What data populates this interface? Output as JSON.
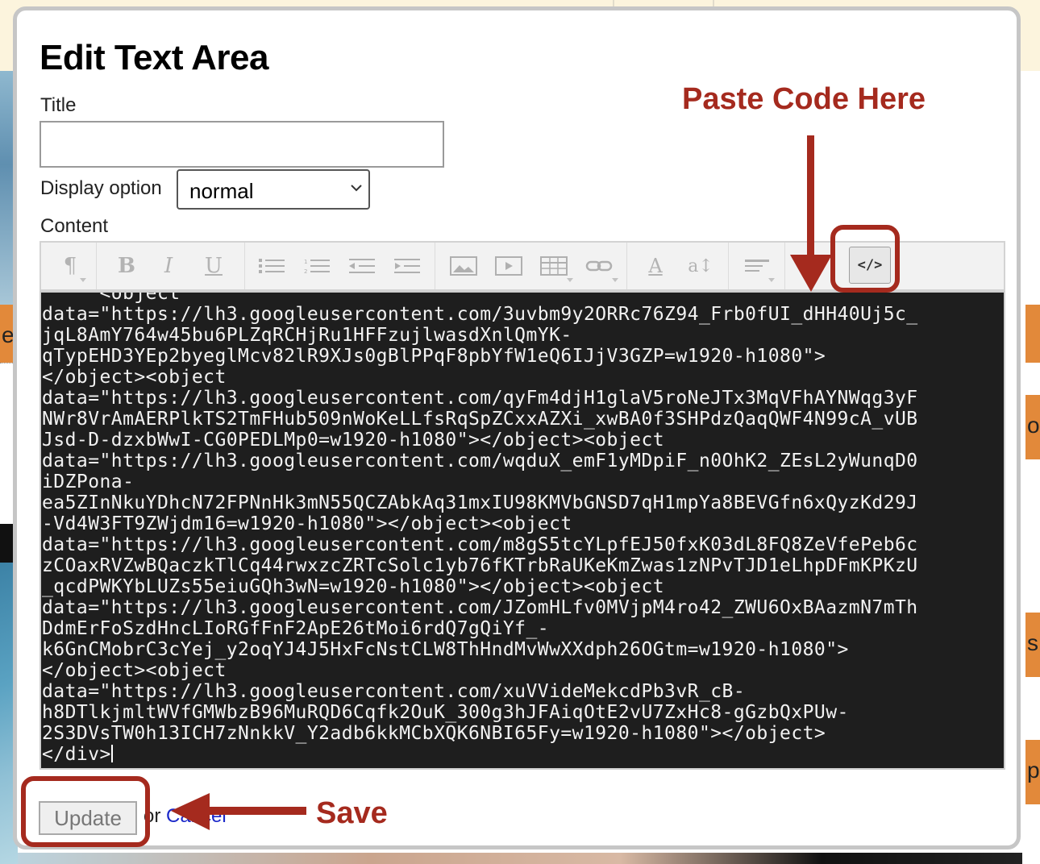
{
  "modal": {
    "title": "Edit Text Area",
    "title_label": "Title",
    "title_value": "",
    "display_option_label": "Display option",
    "display_option_value": "normal",
    "content_label": "Content"
  },
  "toolbar": {
    "buttons": [
      "paragraph",
      "bold",
      "italic",
      "underline",
      "unordered-list",
      "ordered-list",
      "outdent",
      "indent",
      "image",
      "video",
      "table",
      "link",
      "font-color",
      "font-size",
      "align",
      "html-code"
    ],
    "code_button_label": "</>"
  },
  "editor": {
    "lines": [
      "     <object",
      "data=\"https://lh3.googleusercontent.com/3uvbm9y2ORRc76Z94_Frb0fUI_dHH40Uj5c_",
      "jqL8AmY764w45bu6PLZqRCHjRu1HFFzujlwasdXnlQmYK-",
      "qTypEHD3YEp2byeglMcv82lR9XJs0gBlPPqF8pbYfW1eQ6IJjV3GZP=w1920-h1080\">",
      "</object><object",
      "data=\"https://lh3.googleusercontent.com/qyFm4djH1glaV5roNeJTx3MqVFhAYNWqg3yF",
      "NWr8VrAmAERPlkTS2TmFHub509nWoKeLLfsRqSpZCxxAZXi_xwBA0f3SHPdzQaqQWF4N99cA_vUB",
      "Jsd-D-dzxbWwI-CG0PEDLMp0=w1920-h1080\"></object><object",
      "data=\"https://lh3.googleusercontent.com/wqduX_emF1yMDpiF_n0OhK2_ZEsL2yWunqD0",
      "iDZPona-",
      "ea5ZInNkuYDhcN72FPNnHk3mN55QCZAbkAq31mxIU98KMVbGNSD7qH1mpYa8BEVGfn6xQyzKd29J",
      "-Vd4W3FT9ZWjdm16=w1920-h1080\"></object><object",
      "data=\"https://lh3.googleusercontent.com/m8gS5tcYLpfEJ50fxK03dL8FQ8ZeVfePeb6c",
      "zCOaxRVZwBQaczkTlCq44rwxzcZRTcSolc1yb76fKTrbRaUKeKmZwas1zNPvTJD1eLhpDFmKPKzU",
      "_qcdPWKYbLUZs55eiuGQh3wN=w1920-h1080\"></object><object",
      "data=\"https://lh3.googleusercontent.com/JZomHLfv0MVjpM4ro42_ZWU6OxBAazmN7mTh",
      "DdmErFoSzdHncLIoRGfFnF2ApE26tMoi6rdQ7gQiYf_-",
      "k6GnCMobrC3cYej_y2oqYJ4J5HxFcNstCLW8ThHndMvWwXXdph26OGtm=w1920-h1080\">",
      "</object><object",
      "data=\"https://lh3.googleusercontent.com/xuVVideMekcdPb3vR_cB-",
      "h8DTlkjmltWVfGMWbzB96MuRQD6Cqfk2OuK_300g3hJFAiqOtE2vU7ZxHc8-gGzbQxPUw-",
      "2S3DVsTW0h13ICH7zNnkkV_Y2adb6kkMCbXQK6NBI65Fy=w1920-h1080\"></object>",
      "</div>"
    ]
  },
  "footer": {
    "update_label": "Update",
    "or_text": "or",
    "cancel_label": "Cancel"
  },
  "annotations": {
    "paste_code": "Paste Code Here",
    "save": "Save",
    "color": "#a52a1e"
  },
  "background": {
    "left_edge_char": "e",
    "right_edge_chars": [
      "o",
      "s",
      "p"
    ]
  }
}
